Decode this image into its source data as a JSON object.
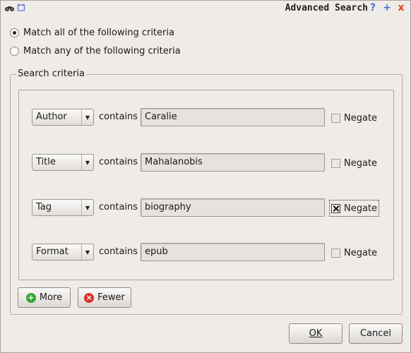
{
  "window": {
    "title": "Advanced Search",
    "title_buttons": [
      "?",
      "+",
      "x"
    ]
  },
  "match": {
    "all_label": "Match all of the following criteria",
    "any_label": "Match any of the following criteria",
    "selected": "all"
  },
  "criteria_group": {
    "legend": "Search criteria",
    "contains_label": "contains",
    "negate_label": "Negate",
    "rows": [
      {
        "field": "Author",
        "value": "Caralie",
        "negate": false
      },
      {
        "field": "Title",
        "value": "Mahalanobis",
        "negate": false
      },
      {
        "field": "Tag",
        "value": "biography",
        "negate": true
      },
      {
        "field": "Format",
        "value": "epub",
        "negate": false
      }
    ]
  },
  "actions": {
    "more_label": "More",
    "fewer_label": "Fewer",
    "ok_label": "OK",
    "cancel_label": "Cancel"
  },
  "colors": {
    "background": "#efebe7",
    "more_icon": "#3aa53a",
    "fewer_icon": "#d9312f",
    "help_icon": "#4a6fd6",
    "close_icon": "#e0452f"
  }
}
